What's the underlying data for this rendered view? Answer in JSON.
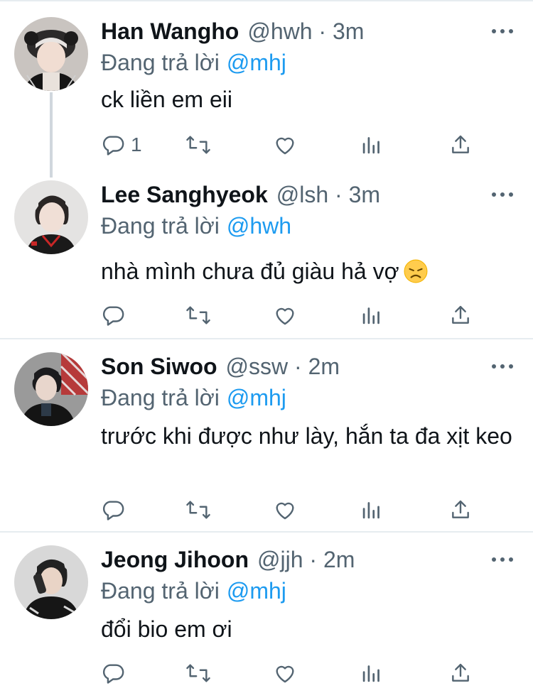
{
  "colors": {
    "text": "#0f1419",
    "muted": "#536471",
    "link": "#1d9bf0",
    "divider": "#e6ecf0"
  },
  "icons": [
    "reply-icon",
    "retweet-icon",
    "like-icon",
    "analytics-icon",
    "share-icon",
    "more-icon",
    "disappointed-face-emoji"
  ],
  "tweets": [
    {
      "name": "Han Wangho",
      "handle_meta": "@hwh · 3m",
      "replying_label": "Đang trả lời",
      "mention": "@mhj",
      "text": "ck liền em eii",
      "reply_count": "1"
    },
    {
      "name": "Lee Sanghyeok",
      "handle_meta": "@lsh · 3m",
      "replying_label": "Đang trả lời",
      "mention": "@hwh",
      "text": "nhà mình chưa đủ giàu hả vợ",
      "reply_count": ""
    },
    {
      "name": "Son Siwoo",
      "handle_meta": "@ssw · 2m",
      "replying_label": "Đang trả lời",
      "mention": "@mhj",
      "text": "trước khi được như lày, hắn ta đa xịt keo",
      "reply_count": ""
    },
    {
      "name": "Jeong Jihoon",
      "handle_meta": "@jjh · 2m",
      "replying_label": "Đang trả lời",
      "mention": "@mhj",
      "text": "đổi bio em ơi",
      "reply_count": ""
    }
  ]
}
